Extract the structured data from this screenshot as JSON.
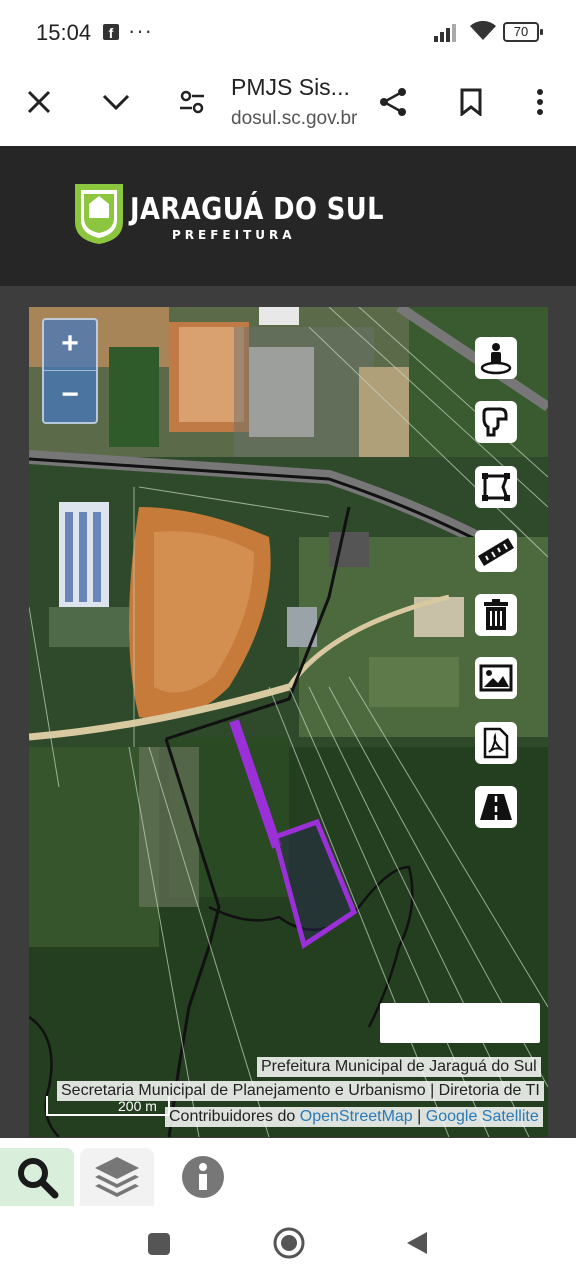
{
  "status_bar": {
    "time": "15:04",
    "notification_icon": "facebook-icon",
    "more": "···",
    "battery": "70"
  },
  "browser": {
    "page_title": "PMJS Sis...",
    "url": "dosul.sc.gov.br",
    "icons": [
      "close-icon",
      "chevron-down-icon",
      "settings-sliders-icon",
      "share-icon",
      "bookmark-icon",
      "more-vert-icon"
    ]
  },
  "header": {
    "logo_title": "JARAGUÁ DO SUL",
    "logo_subtitle": "PREFEITURA",
    "bg_color": "#262626",
    "logo_color": "#8cc63f"
  },
  "map": {
    "zoom_in": "+",
    "zoom_out": "−",
    "tools": [
      "street-view-icon",
      "hand-pan-icon",
      "polygon-select-icon",
      "ruler-icon",
      "trash-icon",
      "image-icon",
      "pdf-icon",
      "road-icon"
    ],
    "scale_label": "200 m",
    "attribution": {
      "line1": "Prefeitura Municipal de Jaraguá do Sul",
      "line2": "Secretaria Municipal de Planejamento e Urbanismo | Diretoria de TI",
      "contrib_prefix": "Contribuidores do ",
      "osm_link": "OpenStreetMap",
      "separator": " | ",
      "satellite_link": "Google Satellite"
    },
    "highlight_color": "#9b30d9"
  },
  "bottom_tabs": [
    {
      "icon": "search-icon",
      "active": true
    },
    {
      "icon": "layers-icon",
      "active": false
    },
    {
      "icon": "info-icon",
      "active": false
    }
  ],
  "nav_bar": [
    "recent-apps-icon",
    "home-icon",
    "back-icon"
  ]
}
